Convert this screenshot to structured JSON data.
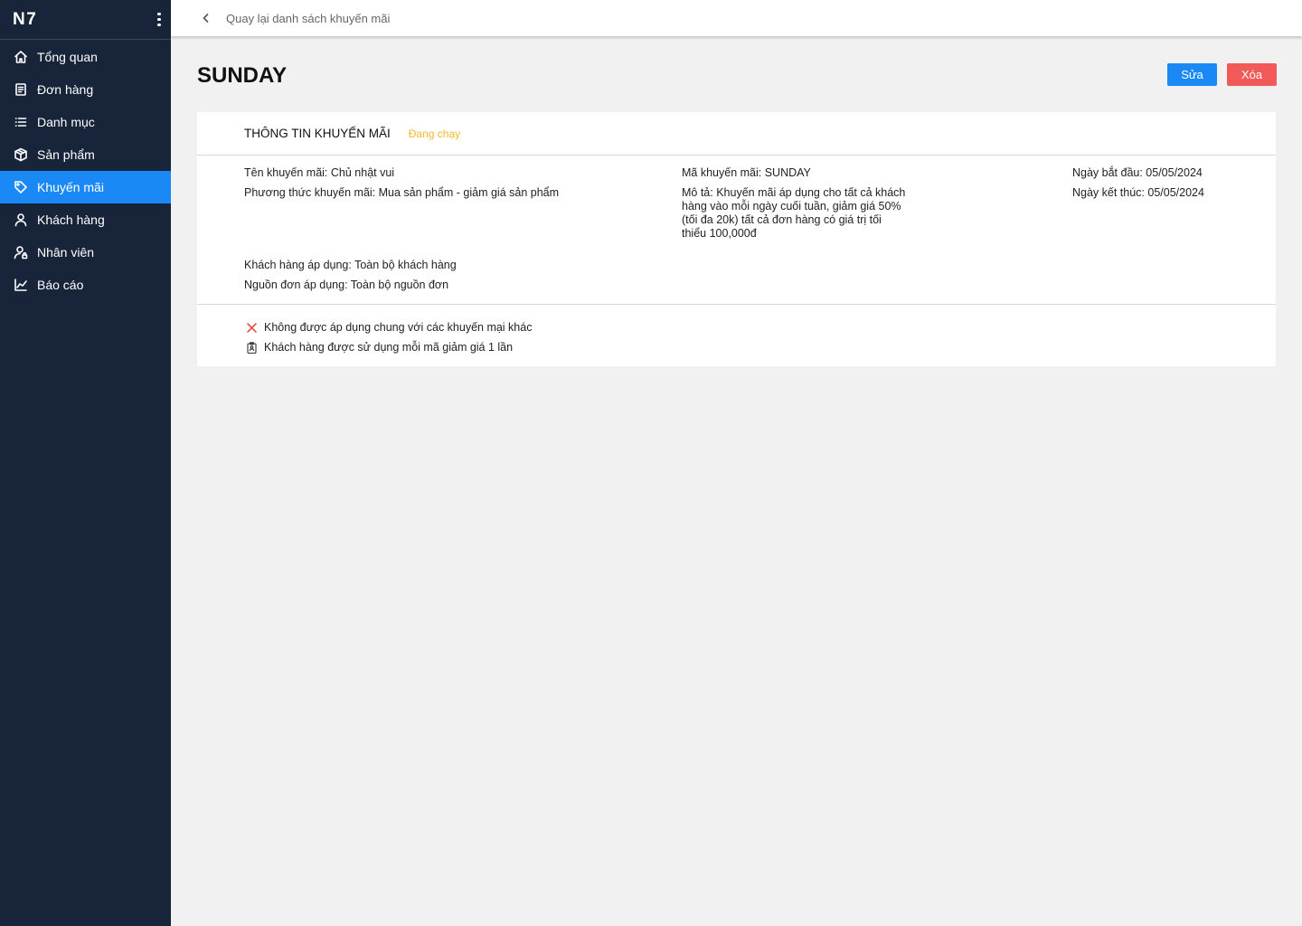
{
  "app": {
    "logo": "N7"
  },
  "sidebar": {
    "items": [
      {
        "label": "Tổng quan",
        "icon": "home-icon"
      },
      {
        "label": "Đơn hàng",
        "icon": "document-icon"
      },
      {
        "label": "Danh mục",
        "icon": "list-icon"
      },
      {
        "label": "Sản phẩm",
        "icon": "box-icon"
      },
      {
        "label": "Khuyến mãi",
        "icon": "tag-icon",
        "active": true
      },
      {
        "label": "Khách hàng",
        "icon": "user-icon"
      },
      {
        "label": "Nhân viên",
        "icon": "user-lock-icon"
      },
      {
        "label": "Báo cáo",
        "icon": "chart-icon"
      }
    ]
  },
  "topbar": {
    "back_label": "Quay lại danh sách khuyến mãi"
  },
  "page": {
    "title": "SUNDAY",
    "edit_label": "Sửa",
    "delete_label": "Xóa"
  },
  "card": {
    "title": "THÔNG TIN KHUYẾN MÃI",
    "status": "Đang chạy",
    "name": "Tên khuyến mãi: Chủ nhật vui",
    "method": "Phương thức khuyến mãi: Mua sản phẩm - giảm giá sản phẩm",
    "code": "Mã khuyến mãi: SUNDAY",
    "description": "Mô tả: Khuyến mãi áp dụng cho tất cả khách hàng vào mỗi ngày cuối tuần, giảm giá 50% (tối đa 20k) tất cả đơn hàng có giá trị tối thiểu 100,000đ",
    "start_date": "Ngày bắt đầu: 05/05/2024",
    "end_date": "Ngày kết thúc: 05/05/2024",
    "customers": "Khách hàng áp dụng: Toàn bộ khách hàng",
    "sources": "Nguồn đơn áp dụng: Toàn bộ nguồn đơn",
    "rules": [
      "Không được áp dụng chung với các khuyến mại khác",
      "Khách hàng được sử dụng mỗi mã giảm giá 1 lần"
    ]
  },
  "colors": {
    "sidebar_bg": "#18243a",
    "accent": "#1a88f5",
    "danger": "#f25a5a",
    "status_running": "#f5b82e"
  }
}
